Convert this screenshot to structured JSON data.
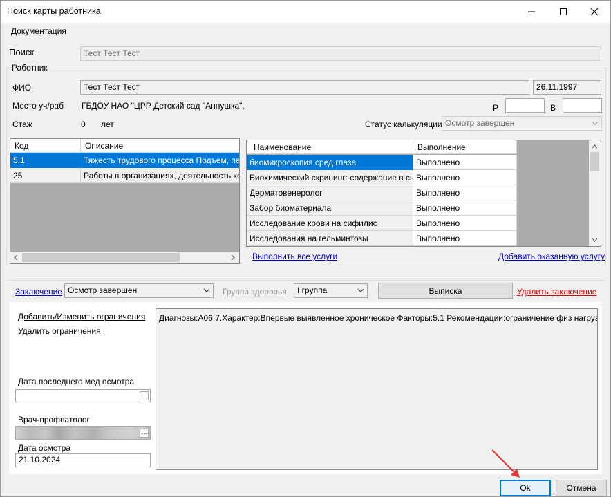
{
  "window": {
    "title": "Поиск карты работника"
  },
  "menu": {
    "documentation": "Документация"
  },
  "search": {
    "label": "Поиск",
    "value": "Тест Тест Тест"
  },
  "worker": {
    "group_title": "Работник",
    "fio_label": "ФИО",
    "fio_value": "Тест Тест Тест",
    "birth_date": "26.11.1997",
    "workplace_label": "Место уч/раб",
    "workplace_value": "ГБДОУ НАО \"ЦРР  Детский сад \"Аннушка\",",
    "r_label": "Р",
    "r_value": "",
    "v_label": "В",
    "v_value": "",
    "experience_label": "Стаж",
    "experience_value": "0",
    "experience_unit": "лет",
    "calc_status_label": "Статус калькуляции",
    "calc_status_value": "Осмотр завершен"
  },
  "factors_table": {
    "columns": [
      "Код",
      "Описание"
    ],
    "rows": [
      {
        "code": "5.1",
        "desc": "Тяжесть трудового процесса Подъем, переме"
      },
      {
        "code": "25",
        "desc": "Работы в организациях, деятельность котор"
      }
    ]
  },
  "services_table": {
    "columns": [
      "Наименование",
      "Выполнение"
    ],
    "rows": [
      {
        "name": "биомикроскопия сред глаза",
        "status": "Выполнено"
      },
      {
        "name": "Биохимический скрининг: содержание в сы...",
        "status": "Выполнено"
      },
      {
        "name": "Дерматовенеролог",
        "status": "Выполнено"
      },
      {
        "name": "Забор биоматериала",
        "status": "Выполнено"
      },
      {
        "name": "Исследование крови на сифилис",
        "status": "Выполнено"
      },
      {
        "name": "Исследования на гельминтозы",
        "status": "Выполнено"
      }
    ]
  },
  "links": {
    "complete_all": "Выполнить все услуги",
    "add_service": "Добавить оказанную услугу"
  },
  "conclusion": {
    "label": "Заключение",
    "value": "Осмотр завершен",
    "health_group_label": "Группа здоровья",
    "health_group_value": "I группа",
    "extract_button": "Выписка",
    "delete_link": "Удалить заключение"
  },
  "restrictions": {
    "add_edit": "Добавить/Изменить ограничения",
    "delete": "Удалить ограничения"
  },
  "last_exam": {
    "label": "Дата последнего мед осмотра",
    "value": ""
  },
  "doctor": {
    "label": "Врач-профпатолог"
  },
  "exam_date": {
    "label": "Дата осмотра",
    "value": "21.10.2024"
  },
  "diagnosis_text": "Диагнозы:А06.7.Характер:Впервые выявленное хроническое  Факторы:5.1 Рекомендации:ограничение физ нагрузк",
  "footer": {
    "ok": "Ok",
    "cancel": "Отмена"
  },
  "colors": {
    "accent": "#0078d7",
    "link": "#0000cc",
    "danger": "#e00000",
    "annotation_arrow": "#e53935"
  }
}
